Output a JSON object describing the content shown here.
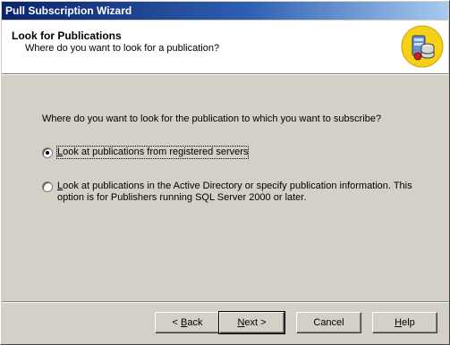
{
  "window": {
    "title": "Pull Subscription Wizard"
  },
  "header": {
    "title": "Look for Publications",
    "subtitle": "Where do you want to look for a publication?"
  },
  "question": "Where do you want to look for the publication to which you want to subscribe?",
  "options": [
    {
      "mnemonic": "L",
      "text": "ook at publications from registered servers",
      "selected": true
    },
    {
      "mnemonic": "L",
      "text": "ook at publications in the Active Directory or specify publication information. This",
      "text2": "option is for Publishers running SQL Server 2000 or later.",
      "selected": false
    }
  ],
  "buttons": {
    "back_prefix": "< ",
    "back_mnemonic": "B",
    "back_rest": "ack",
    "next_mnemonic": "N",
    "next_rest": "ext >",
    "cancel": "Cancel",
    "help_mnemonic": "H",
    "help_rest": "elp"
  }
}
